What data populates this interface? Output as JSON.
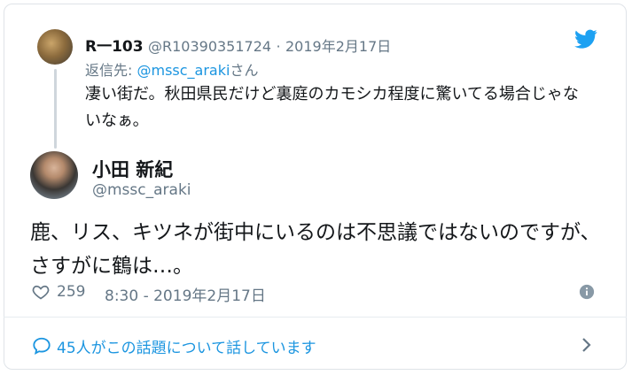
{
  "reply_tweet": {
    "name": "R一103",
    "handle": "@R10390351724",
    "sep": "·",
    "date": "2019年2月17日",
    "reply_prefix": "返信先: ",
    "reply_mention": "@mssc_araki",
    "reply_suffix": "さん",
    "text": "凄い街だ。秋田県民だけど裏庭のカモシカ程度に驚いてる場合じゃないなぁ。"
  },
  "main_tweet": {
    "name": "小田 新紀",
    "handle": "@mssc_araki",
    "text": "鹿、リス、キツネが街中にいるのは不思議ではないのですが、さすがに鶴は…。",
    "likes": "259",
    "time": "8:30 - 2019年2月17日"
  },
  "footer": {
    "talk_text": "45人がこの話題について話しています"
  },
  "icons": {
    "brand": "twitter-bird-icon",
    "like": "heart-icon",
    "info": "info-icon",
    "reply": "speech-bubble-icon",
    "more": "chevron-right-icon"
  },
  "colors": {
    "accent": "#1b95e0",
    "muted": "#657786",
    "text": "#14171a"
  }
}
